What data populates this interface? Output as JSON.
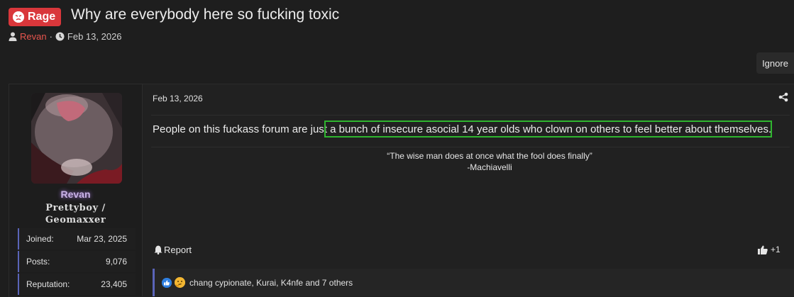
{
  "thread": {
    "prefix": "Rage",
    "title": "Why are everybody here so fucking toxic",
    "author": "Revan",
    "separator": "·",
    "date": "Feb 13, 2026",
    "ignore_label": "Ignore"
  },
  "user": {
    "name": "Revan",
    "title_line1": "Prettyboy /",
    "title_line2": "Geomaxxer",
    "stats": [
      {
        "label": "Joined:",
        "value": "Mar 23, 2025"
      },
      {
        "label": "Posts:",
        "value": "9,076"
      },
      {
        "label": "Reputation:",
        "value": "23,405"
      }
    ]
  },
  "post": {
    "date": "Feb 13, 2026",
    "text_before": "People on this fuckass forum are just",
    "text_highlight": "a bunch of insecure asocial 14 year olds who clown on others to feel better about themselves.",
    "quote": "“The wise man does at once what the fool does finally”",
    "quote_author": "-Machiavelli",
    "report_label": "Report",
    "like_count": "+1",
    "reactions_text": "chang cypionate, Kurai, K4nfe and 7 others"
  }
}
